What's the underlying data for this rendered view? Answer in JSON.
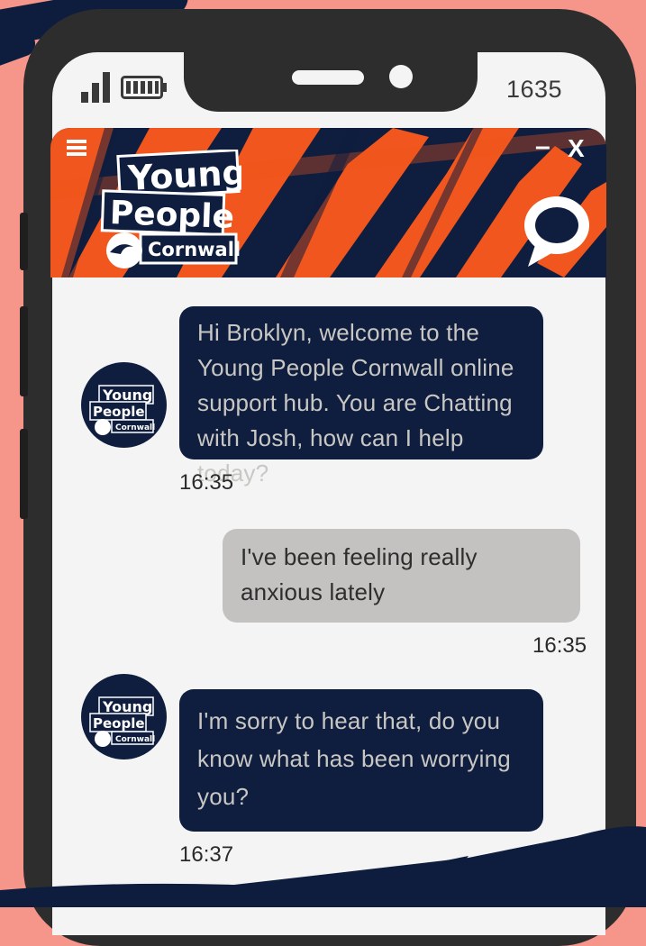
{
  "status_bar": {
    "time": "1635",
    "signal_icon": "signal-bars-icon",
    "battery_icon": "battery-icon"
  },
  "header": {
    "brand_lines": [
      "Young",
      "People",
      "Cornwall"
    ],
    "menu_icon": "hamburger-menu-icon",
    "minimize_label": "–",
    "close_label": "X",
    "chat_icon": "speech-bubble-icon"
  },
  "messages": [
    {
      "sender": "agent",
      "text": "Hi Broklyn, welcome to the Young People Cornwall online support hub. You are Chatting with Josh, how can I help today?",
      "time": "16:35"
    },
    {
      "sender": "user",
      "text": "I've been feeling really anxious lately",
      "time": "16:35"
    },
    {
      "sender": "agent",
      "text": "I'm sorry to hear that, do you know what has been worrying you?",
      "time": "16:37"
    }
  ],
  "colors": {
    "background": "#f6958a",
    "navy": "#0f1e3e",
    "orange": "#f0561d",
    "agent_bubble": "#0f1e3e",
    "user_bubble": "#c3c2c0"
  }
}
